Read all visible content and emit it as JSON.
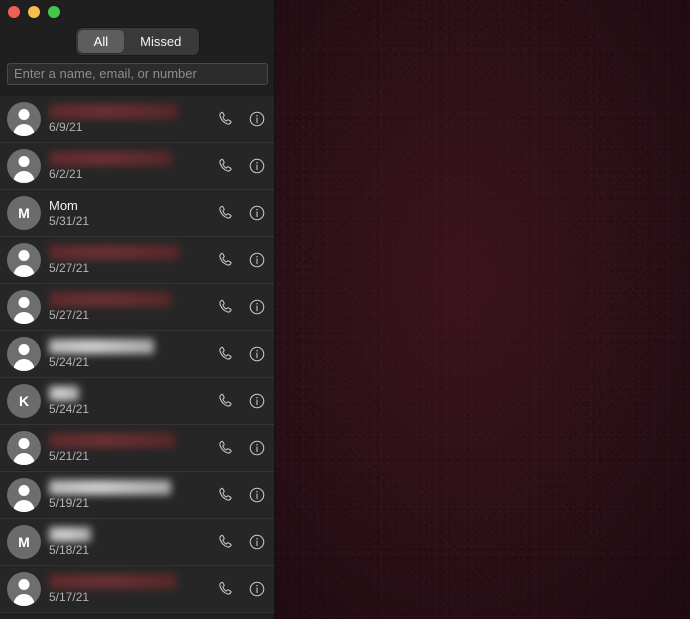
{
  "window": {
    "traffic_lights": [
      {
        "name": "close",
        "color": "#ee5f56"
      },
      {
        "name": "minimize",
        "color": "#f5bd4f"
      },
      {
        "name": "maximize",
        "color": "#43c74a"
      }
    ]
  },
  "filter": {
    "options": [
      {
        "label": "All",
        "selected": true
      },
      {
        "label": "Missed",
        "selected": false
      }
    ]
  },
  "search": {
    "value": "",
    "placeholder": "Enter a name, email, or number"
  },
  "icons": {
    "call": "phone-icon",
    "info": "info-icon"
  },
  "calls": [
    {
      "name": "",
      "redacted": "red",
      "date": "6/9/21",
      "avatar_type": "generic",
      "initial": "",
      "name_width": 128
    },
    {
      "name": "",
      "redacted": "red",
      "date": "6/2/21",
      "avatar_type": "generic",
      "initial": "",
      "name_width": 122
    },
    {
      "name": "Mom",
      "redacted": "",
      "date": "5/31/21",
      "avatar_type": "initial",
      "initial": "M",
      "name_width": 0
    },
    {
      "name": "",
      "redacted": "red",
      "date": "5/27/21",
      "avatar_type": "generic",
      "initial": "",
      "name_width": 130
    },
    {
      "name": "",
      "redacted": "red",
      "date": "5/27/21",
      "avatar_type": "generic",
      "initial": "",
      "name_width": 122
    },
    {
      "name": "",
      "redacted": "grey",
      "date": "5/24/21",
      "avatar_type": "generic",
      "initial": "",
      "name_width": 105
    },
    {
      "name": "",
      "redacted": "grey",
      "date": "5/24/21",
      "avatar_type": "initial",
      "initial": "K",
      "name_width": 30
    },
    {
      "name": "",
      "redacted": "red",
      "date": "5/21/21",
      "avatar_type": "generic",
      "initial": "",
      "name_width": 126
    },
    {
      "name": "",
      "redacted": "grey",
      "date": "5/19/21",
      "avatar_type": "generic",
      "initial": "",
      "name_width": 122
    },
    {
      "name": "",
      "redacted": "grey",
      "date": "5/18/21",
      "avatar_type": "initial",
      "initial": "M",
      "name_width": 42
    },
    {
      "name": "",
      "redacted": "red",
      "date": "5/17/21",
      "avatar_type": "generic",
      "initial": "",
      "name_width": 128
    }
  ],
  "colors": {
    "sidebar_bg": "#1f1f1f",
    "row_bg": "#262626",
    "row_divider": "#343434",
    "main_bg": "#2e1018",
    "accent_selected": "#5d5d5d",
    "text_primary": "#f0f0f0",
    "text_secondary": "#b6b6b6"
  }
}
